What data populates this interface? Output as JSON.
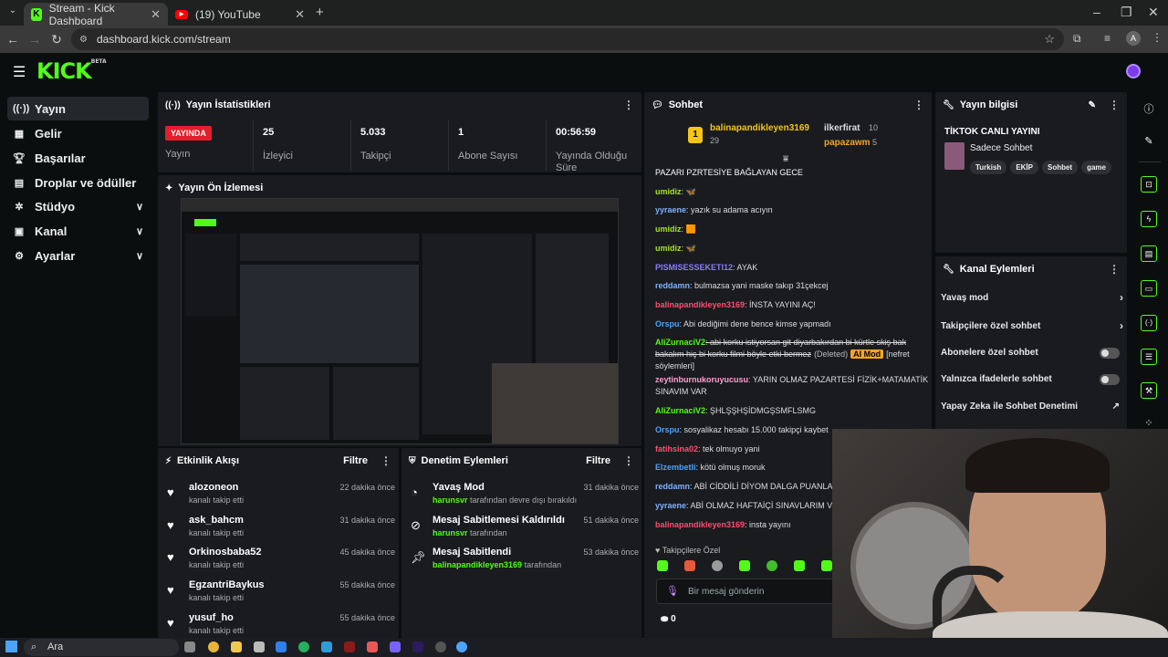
{
  "browser": {
    "tabs": [
      {
        "title": "Stream - Kick Dashboard",
        "active": true,
        "icon": "kick-icon"
      },
      {
        "title": "(19) YouTube",
        "active": false,
        "icon": "youtube-icon"
      }
    ],
    "url": "dashboard.kick.com/stream"
  },
  "app": {
    "logo": "KICK",
    "logo_sup": "BETA"
  },
  "sidebar": {
    "items": [
      {
        "label": "Yayın",
        "icon": "stream-icon",
        "active": true
      },
      {
        "label": "Gelir",
        "icon": "revenue-icon"
      },
      {
        "label": "Başarılar",
        "icon": "trophy-icon"
      },
      {
        "label": "Droplar ve ödüller",
        "icon": "gift-icon"
      },
      {
        "label": "Stüdyo",
        "icon": "studio-icon",
        "expandable": true
      },
      {
        "label": "Kanal",
        "icon": "channel-icon",
        "expandable": true
      },
      {
        "label": "Ayarlar",
        "icon": "gear-icon",
        "expandable": true
      }
    ]
  },
  "stats": {
    "title": "Yayın İstatistikleri",
    "live_badge": "YAYINDA",
    "live_label": "Yayın",
    "viewers": {
      "value": "25",
      "label": "İzleyici"
    },
    "followers": {
      "value": "5.033",
      "label": "Takipçi"
    },
    "subs": {
      "value": "1",
      "label": "Abone Sayısı"
    },
    "uptime": {
      "value": "00:56:59",
      "label": "Yayında Olduğu Süre"
    }
  },
  "preview": {
    "title": "Yayın Ön İzlemesi"
  },
  "activity": {
    "title": "Etkinlik Akışı",
    "filter": "Filtre",
    "items": [
      {
        "name": "alozoneon",
        "action": "kanalı takip etti",
        "time": "22 dakika önce"
      },
      {
        "name": "ask_bahcm",
        "action": "kanalı takip etti",
        "time": "31 dakika önce"
      },
      {
        "name": "Orkinosbaba52",
        "action": "kanalı takip etti",
        "time": "45 dakika önce"
      },
      {
        "name": "EgzantriBaykus",
        "action": "kanalı takip etti",
        "time": "55 dakika önce"
      },
      {
        "name": "yusuf_ho",
        "action": "kanalı takip etti",
        "time": "55 dakika önce"
      }
    ]
  },
  "moderation": {
    "title": "Denetim Eylemleri",
    "filter": "Filtre",
    "items": [
      {
        "title": "Yavaş Mod",
        "user": "harunsvr",
        "rest": "tarafından devre dışı bırakıldı",
        "time": "31 dakika önce"
      },
      {
        "title": "Mesaj Sabitlemesi Kaldırıldı",
        "user": "harunsvr",
        "rest": "tarafından",
        "time": "51 dakika önce"
      },
      {
        "title": "Mesaj Sabitlendi",
        "user": "balinapandikleyen3169",
        "rest": "tarafından",
        "time": "53 dakika önce"
      }
    ]
  },
  "chat": {
    "title": "Sohbet",
    "top_gifter": {
      "rank": "1",
      "name": "balinapandikleyen3169",
      "count": "29"
    },
    "gifters": [
      {
        "name": "ilkerfirat",
        "count": "10"
      },
      {
        "name": "papazawm",
        "count": "5"
      }
    ],
    "messages": [
      {
        "user": "",
        "text": "PAZARI PZRTESİYE BAĞLAYAN GECE",
        "color": "#ffffff"
      },
      {
        "user": "umidiz",
        "text": ": 🦋",
        "color": "#a6e22e"
      },
      {
        "user": "yyraene",
        "text": ": yazık su adama acıyın",
        "color": "#7fb2ff"
      },
      {
        "user": "umidiz",
        "text": ": 🟧",
        "color": "#a6e22e"
      },
      {
        "user": "umidiz",
        "text": ": 🦋",
        "color": "#a6e22e"
      },
      {
        "user": "PISMISESSEKETI12",
        "text": ": AYAK",
        "color": "#8a7dff"
      },
      {
        "user": "reddamn",
        "text": ": bulmazsa yani maske takıp 31çekcej",
        "color": "#7fb2ff"
      },
      {
        "user": "balinapandikleyen3169",
        "text": ": İNSTA YAYINI AÇ!",
        "color": "#ff4d6d"
      },
      {
        "user": "Orspu",
        "text": ": Abi dediğimi dene bence kimse yapmadı",
        "color": "#4aa3ff"
      },
      {
        "user": "AliZurnaciV2",
        "text": ": abi korku istiyorsan git diyarbakırdan bi kürtle skiş bak bakalım hiç bi korku filmi böyle etki bermez",
        "color": "#53fc18",
        "deleted": "(Deleted)",
        "mod": "AI Mod",
        "note": "[nefret söylemleri]"
      },
      {
        "user": "zeytinburnukoruyucusu",
        "text": ": YARIN OLMAZ PAZARTESİ FİZİK+MATAMATİK SINAVIM VAR",
        "color": "#ff9ecf"
      },
      {
        "user": "AliZurnaciV2",
        "text": ": ŞHLŞŞHŞİDMGŞSMFLSMG",
        "color": "#53fc18"
      },
      {
        "user": "Orspu",
        "text": ": sosyalikaz hesabı 15.000 takipçi kaybet",
        "color": "#4aa3ff"
      },
      {
        "user": "fatihsina02",
        "text": ": tek olmuyo yani",
        "color": "#ff4d6d"
      },
      {
        "user": "Elzembetli",
        "text": ": kötü olmuş moruk",
        "color": "#4aa3ff"
      },
      {
        "user": "reddamn",
        "text": ": ABİ CİDDİLİ DİYOM DALGA PUANLAI",
        "color": "#7fb2ff"
      },
      {
        "user": "yyraene",
        "text": ": ABİ OLMAZ HAFTAİÇİ SINAVLARIM V...",
        "color": "#7fb2ff"
      },
      {
        "user": "balinapandikleyen3169",
        "text": ": insta yayını",
        "color": "#ff4d6d"
      }
    ],
    "followers_only": "Takipçilere Özel",
    "input_placeholder": "Bir mesaj gönderin",
    "points": "0"
  },
  "stream_info": {
    "title": "Yayın bilgisi",
    "stream_title": "TİKTOK CANLI YAYINI",
    "category": "Sadece Sohbet",
    "tags": [
      "Turkish",
      "EKİP",
      "Sohbet",
      "game"
    ]
  },
  "channel_actions": {
    "title": "Kanal Eylemleri",
    "items": [
      {
        "label": "Yavaş mod",
        "kind": "arrow"
      },
      {
        "label": "Takipçilere özel sohbet",
        "kind": "arrow"
      },
      {
        "label": "Abonelere özel sohbet",
        "kind": "toggle"
      },
      {
        "label": "Yalnızca ifadelerle sohbet",
        "kind": "toggle"
      },
      {
        "label": "Yapay Zeka ile Sohbet Denetimi",
        "kind": "external"
      }
    ]
  },
  "taskbar": {
    "search": "Ara"
  },
  "colors": {
    "brand": "#53fc18",
    "live": "#e41e2b",
    "panel": "#191b1f",
    "bg": "#0b0e0f"
  }
}
